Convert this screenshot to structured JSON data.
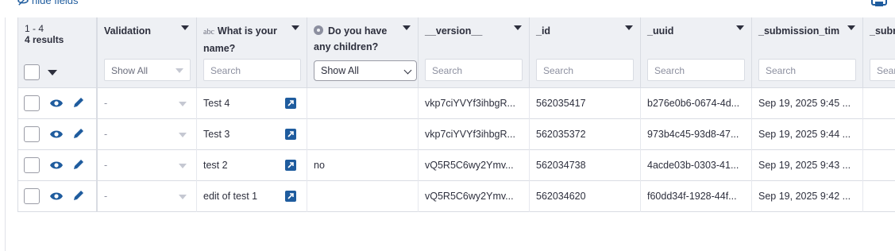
{
  "toolbar": {
    "hide_fields_label": "hide fields"
  },
  "table": {
    "results_range": "1 - 4",
    "results_count": "4 results",
    "columns": [
      {
        "title": "Validation",
        "filter_type": "select",
        "filter_value": "Show All"
      },
      {
        "title": "What is your name?",
        "type_label": "abc",
        "filter_type": "input",
        "filter_placeholder": "Search"
      },
      {
        "title": "Do you have any children?",
        "filter_type": "native-select",
        "filter_value": "Show All"
      },
      {
        "title": "__version__",
        "filter_type": "input",
        "filter_placeholder": "Search"
      },
      {
        "title": "_id",
        "filter_type": "input",
        "filter_placeholder": "Search"
      },
      {
        "title": "_uuid",
        "filter_type": "input",
        "filter_placeholder": "Search"
      },
      {
        "title": "_submission_tim",
        "filter_type": "input",
        "filter_placeholder": "Search"
      },
      {
        "title": "_subm",
        "filter_type": "input",
        "filter_placeholder": "Sear"
      }
    ],
    "rows": [
      {
        "validation": "-",
        "name": "Test 4",
        "children": "",
        "version": "vkp7ciYVYf3ihbgR...",
        "id": "562035417",
        "uuid": "b276e0b6-0674-4d...",
        "submission_time": "Sep 19, 2025 9:45 ..."
      },
      {
        "validation": "-",
        "name": "Test 3",
        "children": "",
        "version": "vkp7ciYVYf3ihbgR...",
        "id": "562035372",
        "uuid": "973b4c45-93d8-47...",
        "submission_time": "Sep 19, 2025 9:44 ..."
      },
      {
        "validation": "-",
        "name": "test 2",
        "children": "no",
        "version": "vQ5R5C6wy2Ymv...",
        "id": "562034738",
        "uuid": "4acde03b-0303-41...",
        "submission_time": "Sep 19, 2025 9:43 ..."
      },
      {
        "validation": "-",
        "name": "edit of test 1",
        "children": "",
        "version": "vQ5R5C6wy2Ymv...",
        "id": "562034620",
        "uuid": "f60dd34f-1928-44f...",
        "submission_time": "Sep 19, 2025 9:42 ..."
      }
    ]
  },
  "colors": {
    "accent": "#1f5c9e",
    "header_bg": "#eef0f4",
    "border": "#d9dce3"
  }
}
